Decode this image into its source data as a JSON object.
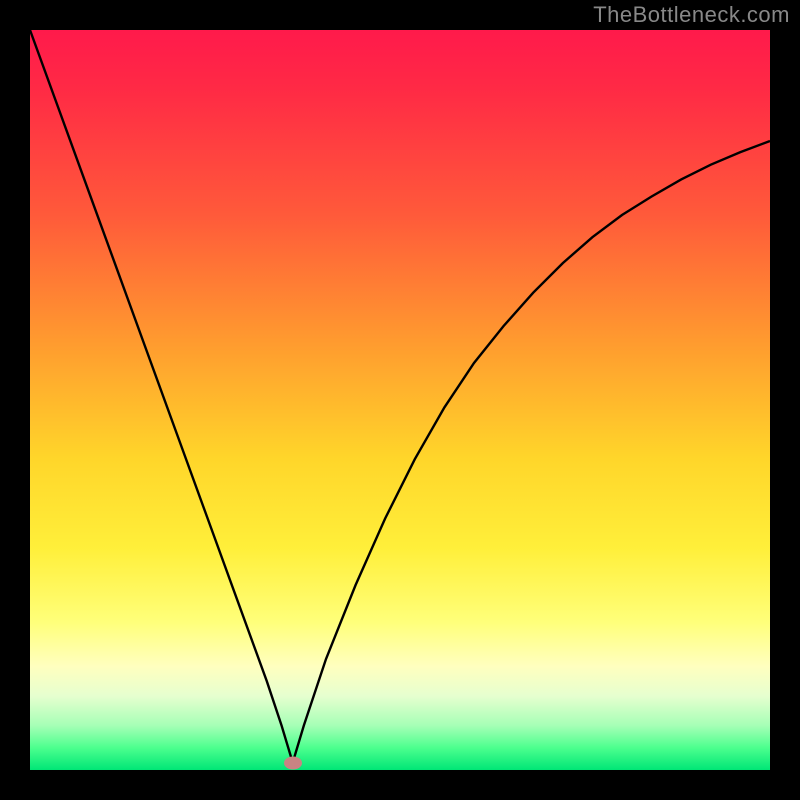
{
  "watermark": "TheBottleneck.com",
  "chart_data": {
    "type": "line",
    "title": "",
    "xlabel": "",
    "ylabel": "",
    "xlim": [
      0,
      100
    ],
    "ylim": [
      0,
      100
    ],
    "grid": false,
    "legend": false,
    "series": [
      {
        "name": "bottleneck-curve",
        "x": [
          0,
          4,
          8,
          12,
          16,
          20,
          24,
          28,
          32,
          34,
          35.5,
          37,
          40,
          44,
          48,
          52,
          56,
          60,
          64,
          68,
          72,
          76,
          80,
          84,
          88,
          92,
          96,
          100
        ],
        "values": [
          100,
          89,
          78,
          67,
          56,
          45,
          34,
          23,
          12,
          6,
          1,
          6,
          15,
          25,
          34,
          42,
          49,
          55,
          60,
          64.5,
          68.5,
          72,
          75,
          77.5,
          79.8,
          81.8,
          83.5,
          85
        ]
      }
    ],
    "min_point": {
      "x": 35.5,
      "y": 1
    },
    "colors": {
      "curve": "#000000",
      "min_marker": "#c98383",
      "gradient_top": "#ff1a4b",
      "gradient_bottom": "#00e676",
      "background": "#000000"
    },
    "annotations": [],
    "tick_labels": {
      "x": [],
      "y": []
    }
  }
}
